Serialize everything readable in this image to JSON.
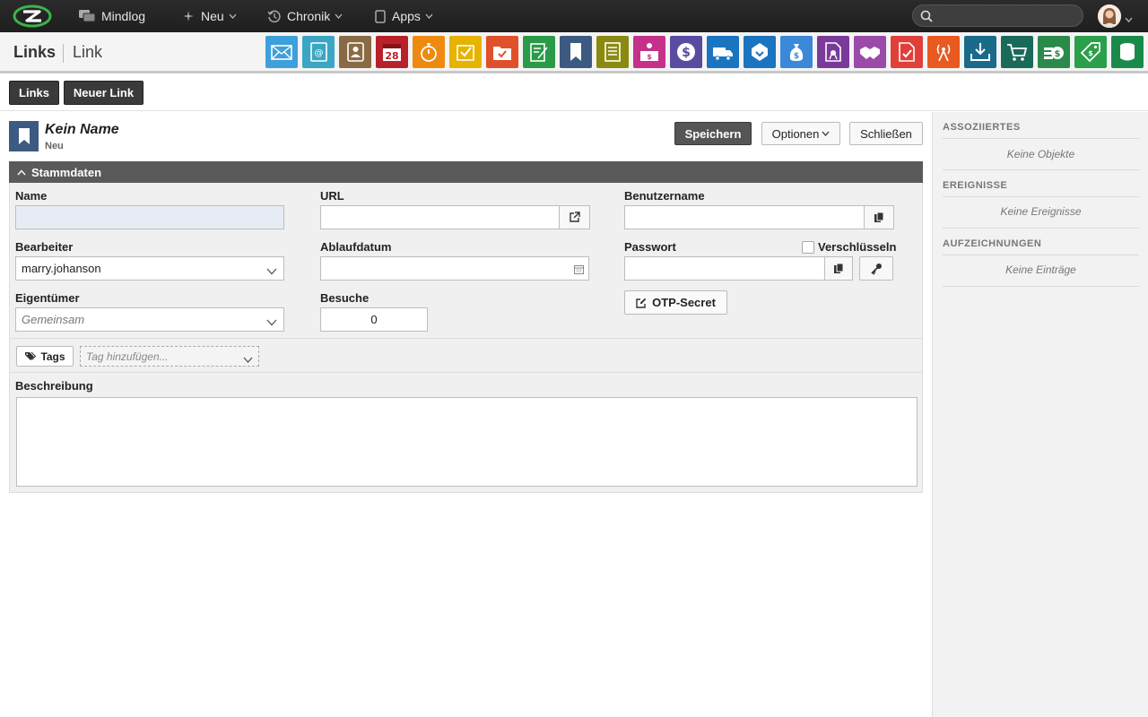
{
  "topbar": {
    "nav": [
      {
        "label": "Mindlog",
        "icon": "chat-bubbles-icon"
      },
      {
        "label": "Neu",
        "icon": "sparkle-icon"
      },
      {
        "label": "Chronik",
        "icon": "history-icon"
      },
      {
        "label": "Apps",
        "icon": "tablet-icon"
      }
    ],
    "search_placeholder": ""
  },
  "header": {
    "title": "Links",
    "subtitle": "Link",
    "tiles": [
      {
        "name": "mail",
        "color": "#3ea0da"
      },
      {
        "name": "address-book",
        "color": "#3aa6c4"
      },
      {
        "name": "contacts",
        "color": "#8a6a45"
      },
      {
        "name": "calendar",
        "color": "#b8202a",
        "text": "28"
      },
      {
        "name": "timer",
        "color": "#ee8a10"
      },
      {
        "name": "tasks",
        "color": "#e6b300"
      },
      {
        "name": "projects",
        "color": "#e0502a"
      },
      {
        "name": "notes",
        "color": "#2a9a48"
      },
      {
        "name": "bookmark",
        "color": "#3d5a80"
      },
      {
        "name": "documents",
        "color": "#8a8a10"
      },
      {
        "name": "sales",
        "color": "#c4308a"
      },
      {
        "name": "finance",
        "color": "#5a4aa0"
      },
      {
        "name": "delivery",
        "color": "#1a74c0"
      },
      {
        "name": "support",
        "color": "#1a74c0"
      },
      {
        "name": "budget",
        "color": "#3a88d8"
      },
      {
        "name": "contracts",
        "color": "#7a3a9a"
      },
      {
        "name": "deals",
        "color": "#9a4aa8"
      },
      {
        "name": "pdf",
        "color": "#e0403a"
      },
      {
        "name": "broadcast",
        "color": "#e85a20"
      },
      {
        "name": "downloads",
        "color": "#1a6a8a"
      },
      {
        "name": "shop",
        "color": "#1a6a5a"
      },
      {
        "name": "payments",
        "color": "#2a8a4a"
      },
      {
        "name": "pricing",
        "color": "#2aa04a"
      },
      {
        "name": "database",
        "color": "#1a8a4a"
      }
    ]
  },
  "buttonbar": {
    "links_label": "Links",
    "new_link_label": "Neuer Link"
  },
  "record": {
    "title": "Kein Name",
    "status": "Neu",
    "save_label": "Speichern",
    "options_label": "Optionen",
    "close_label": "Schließen"
  },
  "form": {
    "section_title": "Stammdaten",
    "name_label": "Name",
    "name_value": "",
    "url_label": "URL",
    "url_value": "",
    "username_label": "Benutzername",
    "username_value": "",
    "editor_label": "Bearbeiter",
    "editor_value": "marry.johanson",
    "expiry_label": "Ablaufdatum",
    "expiry_value": "",
    "password_label": "Passwort",
    "encrypt_label": "Verschlüsseln",
    "owner_label": "Eigentümer",
    "owner_value": "Gemeinsam",
    "visits_label": "Besuche",
    "visits_value": "0",
    "otp_label": "OTP-Secret",
    "tags_label": "Tags",
    "tag_placeholder": "Tag hinzufügen...",
    "description_label": "Beschreibung"
  },
  "sidebar": {
    "associated_title": "ASSOZIIERTES",
    "associated_empty": "Keine Objekte",
    "events_title": "EREIGNISSE",
    "events_empty": "Keine Ereignisse",
    "records_title": "AUFZEICHNUNGEN",
    "records_empty": "Keine Einträge"
  }
}
